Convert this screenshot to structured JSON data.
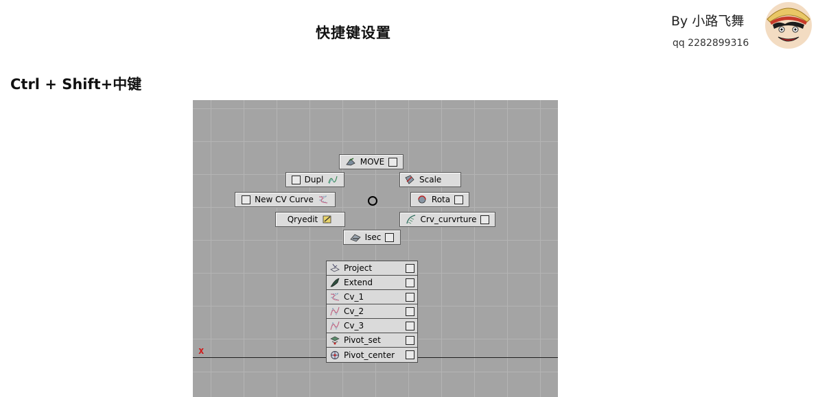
{
  "header": {
    "title": "快捷键设置",
    "author": "By  小路飞舞",
    "qq": "qq  2282899316"
  },
  "section": {
    "title": "Ctrl + Shift+中键"
  },
  "viewport": {
    "axis_marker": "x"
  },
  "marking_menu": {
    "items": [
      {
        "label": "MOVE",
        "icon": "move-icon",
        "checkbox": true
      },
      {
        "label": "Dupl",
        "icon": "duplicate-curve-icon",
        "checkbox": true
      },
      {
        "label": "Scale",
        "icon": "scale-icon",
        "checkbox": false
      },
      {
        "label": "New CV Curve",
        "icon": "cv-curve-icon",
        "checkbox": true
      },
      {
        "label": "Rota",
        "icon": "rotate-icon",
        "checkbox": true
      },
      {
        "label": "Qryedit",
        "icon": "query-edit-icon",
        "checkbox": false
      },
      {
        "label": "Crv_curvrture",
        "icon": "curvature-icon",
        "checkbox": true
      },
      {
        "label": "Isec",
        "icon": "intersect-icon",
        "checkbox": true
      }
    ]
  },
  "tool_list": {
    "items": [
      {
        "label": "Project",
        "icon": "project-icon"
      },
      {
        "label": "Extend",
        "icon": "extend-icon"
      },
      {
        "label": "Cv_1",
        "icon": "cv-curve-icon"
      },
      {
        "label": "Cv_2",
        "icon": "cv-curve-icon"
      },
      {
        "label": "Cv_3",
        "icon": "cv-curve-icon"
      },
      {
        "label": "Pivot_set",
        "icon": "pivot-set-icon"
      },
      {
        "label": "Pivot_center",
        "icon": "pivot-center-icon"
      }
    ]
  }
}
